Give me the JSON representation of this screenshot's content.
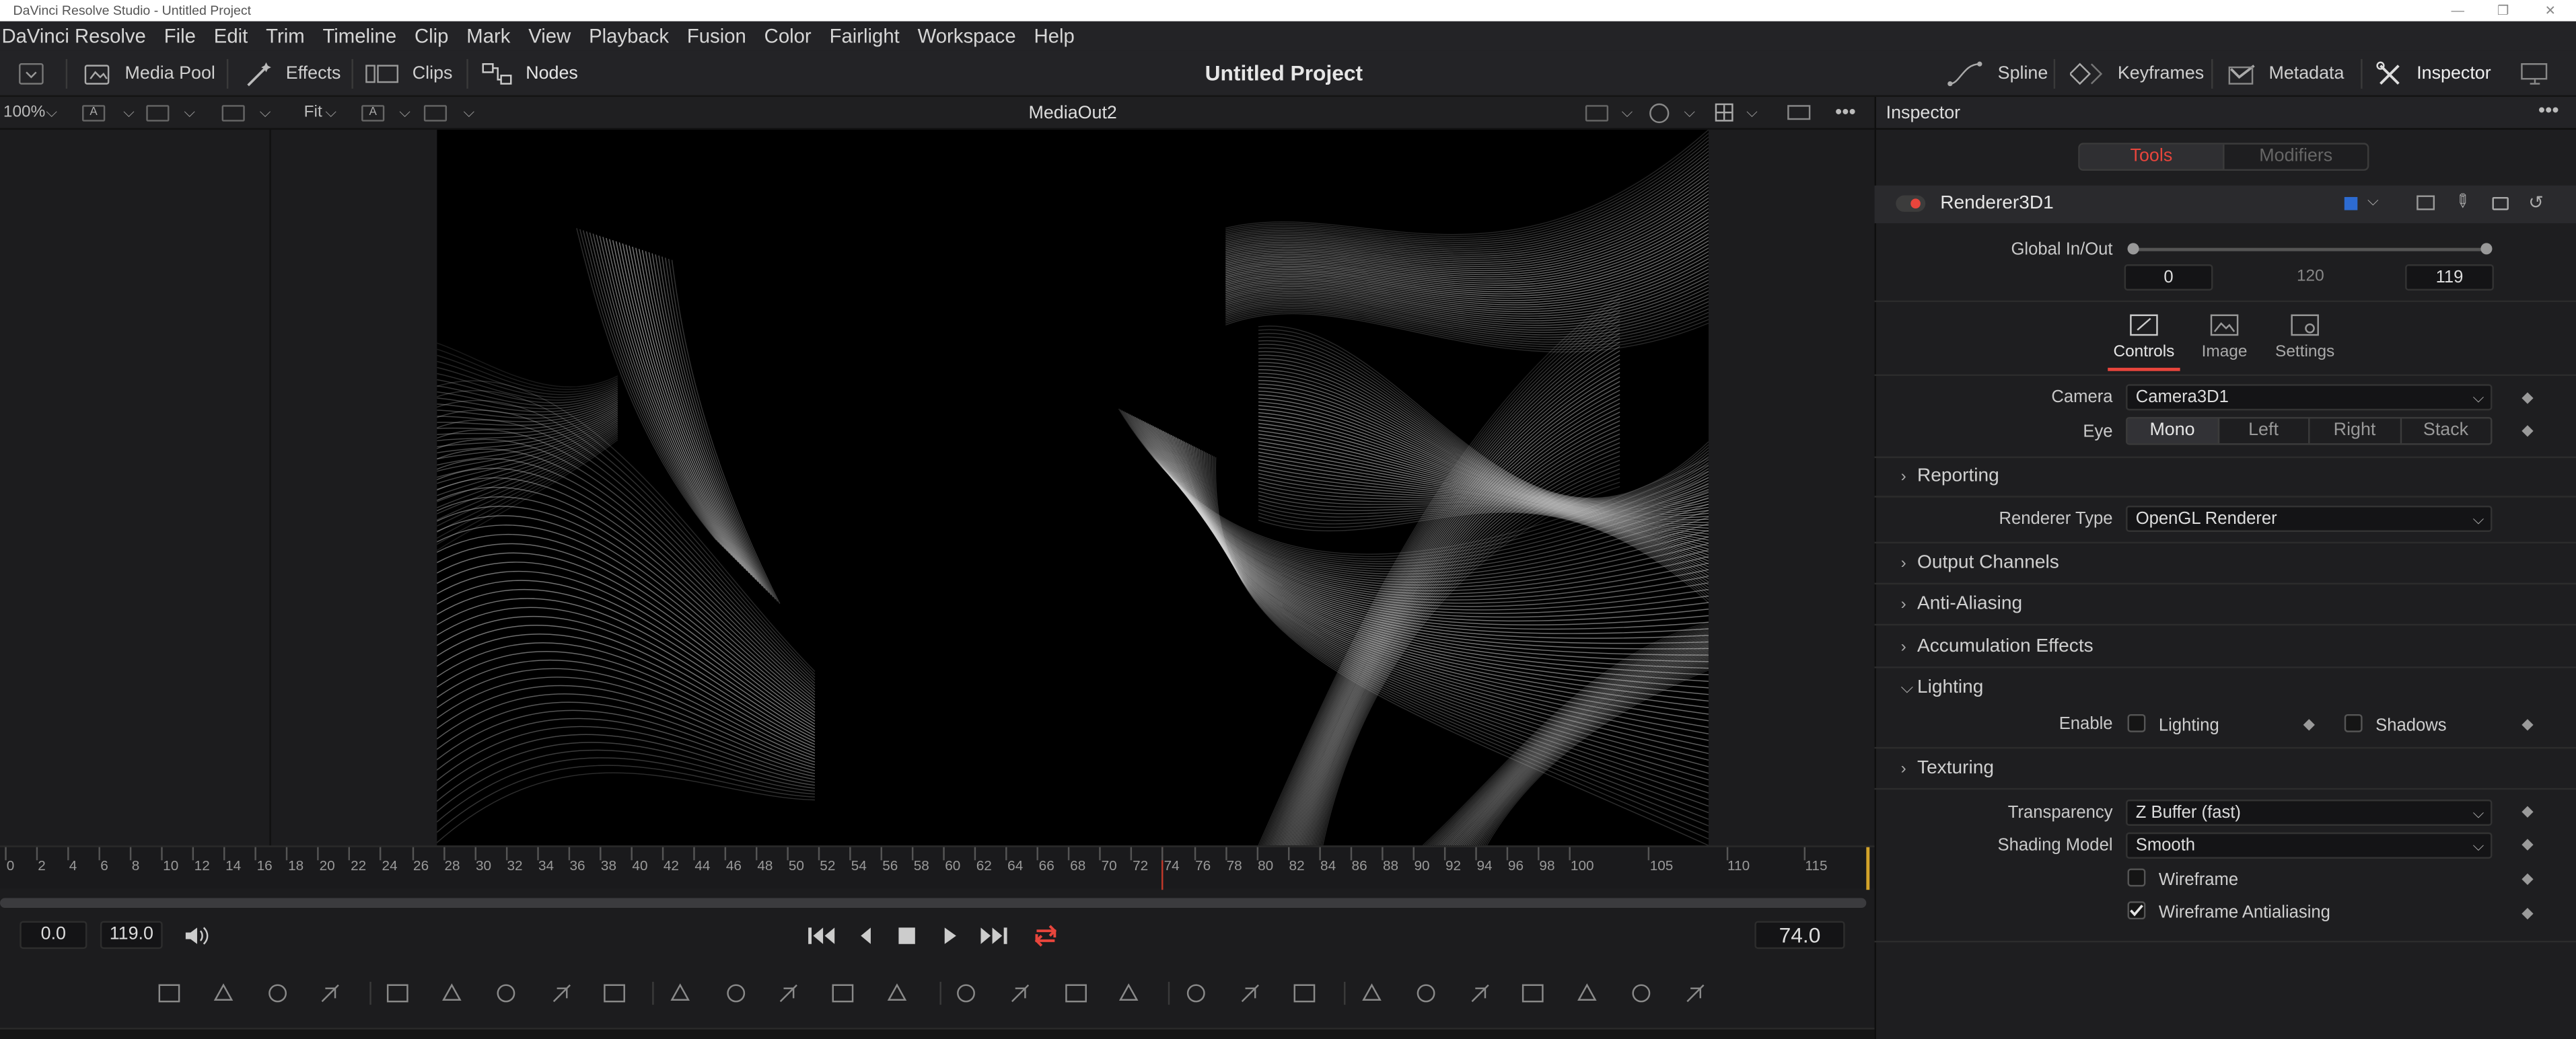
{
  "window": {
    "title": "DaVinci Resolve Studio - Untitled Project"
  },
  "menu": [
    "DaVinci Resolve",
    "File",
    "Edit",
    "Trim",
    "Timeline",
    "Clip",
    "Mark",
    "View",
    "Playback",
    "Fusion",
    "Color",
    "Fairlight",
    "Workspace",
    "Help"
  ],
  "toolbar": {
    "media_pool": "Media Pool",
    "effects": "Effects",
    "clips": "Clips",
    "nodes": "Nodes",
    "project_title": "Untitled Project",
    "spline": "Spline",
    "keyframes": "Keyframes",
    "metadata": "Metadata",
    "inspector": "Inspector"
  },
  "viewer": {
    "zoom": "100%",
    "fit": "Fit",
    "name": "MediaOut2",
    "box_a1": "A",
    "box_a2": "A"
  },
  "timeline": {
    "ticks": [
      "0",
      "2",
      "4",
      "6",
      "8",
      "10",
      "12",
      "14",
      "16",
      "18",
      "20",
      "22",
      "24",
      "26",
      "28",
      "30",
      "32",
      "34",
      "36",
      "38",
      "40",
      "42",
      "44",
      "46",
      "48",
      "50",
      "52",
      "54",
      "56",
      "58",
      "60",
      "62",
      "64",
      "66",
      "68",
      "70",
      "72",
      "74",
      "76",
      "78",
      "80",
      "82",
      "84",
      "86",
      "88",
      "90",
      "92",
      "94",
      "96",
      "98",
      "100",
      "105",
      "110",
      "115"
    ],
    "playhead_frame": 74,
    "start": "0.0",
    "end": "119.0",
    "current": "74.0"
  },
  "inspector": {
    "title": "Inspector",
    "tabs": {
      "tools": "Tools",
      "modifiers": "Modifiers"
    },
    "node_name": "Renderer3D1",
    "global_in_out_label": "Global In/Out",
    "global_in": "0",
    "global_mid": "120",
    "global_out": "119",
    "subtabs": {
      "controls": "Controls",
      "image": "Image",
      "settings": "Settings"
    },
    "camera_label": "Camera",
    "camera_value": "Camera3D1",
    "eye_label": "Eye",
    "eye_options": [
      "Mono",
      "Left",
      "Right",
      "Stack"
    ],
    "sections": {
      "reporting": "Reporting",
      "output_channels": "Output Channels",
      "anti_aliasing": "Anti-Aliasing",
      "accumulation": "Accumulation Effects",
      "lighting": "Lighting",
      "texturing": "Texturing"
    },
    "renderer_type_label": "Renderer Type",
    "renderer_type_value": "OpenGL Renderer",
    "enable_label": "Enable",
    "lighting_cb": "Lighting",
    "shadows_cb": "Shadows",
    "transparency_label": "Transparency",
    "transparency_value": "Z Buffer (fast)",
    "shading_label": "Shading Model",
    "shading_value": "Smooth",
    "wireframe_cb": "Wireframe",
    "wireframe_aa_cb": "Wireframe Antialiasing",
    "wireframe_aa_checked": true
  },
  "colors": {
    "accent_red": "#e8453c",
    "node_blue": "#2d6bd1",
    "playhead": "#c0392b"
  }
}
